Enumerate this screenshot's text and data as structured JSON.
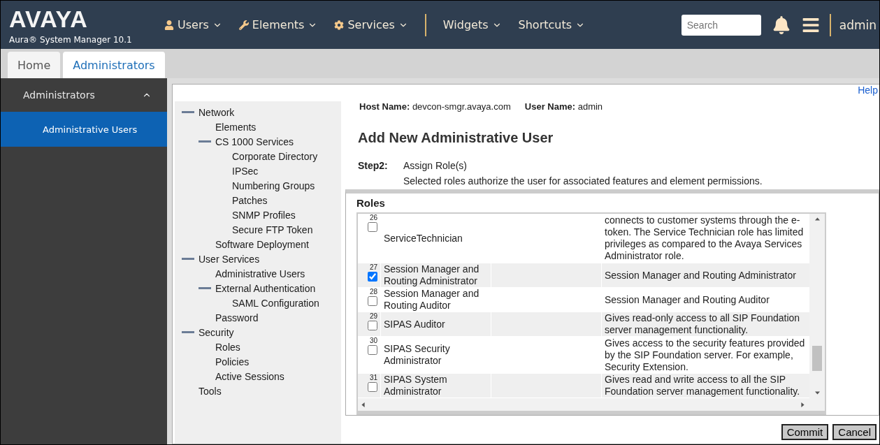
{
  "header": {
    "logo": "AVAYA",
    "product": "Aura® System Manager 10.1",
    "menus": [
      {
        "label": "Users"
      },
      {
        "label": "Elements"
      },
      {
        "label": "Services"
      }
    ],
    "menus2": [
      {
        "label": "Widgets"
      },
      {
        "label": "Shortcuts"
      }
    ],
    "search": {
      "placeholder": "Search"
    },
    "user": "admin"
  },
  "tabs": [
    {
      "label": "Home",
      "selected": false
    },
    {
      "label": "Administrators",
      "selected": true
    }
  ],
  "sidebar": {
    "section": {
      "label": "Administrators",
      "expanded": true
    },
    "items": [
      {
        "label": "Administrative Users",
        "selected": true
      }
    ]
  },
  "help": "Help",
  "tree": [
    {
      "label": "Network",
      "expanded": true,
      "children": [
        {
          "label": "Elements"
        },
        {
          "label": "CS 1000 Services",
          "expanded": true,
          "children": [
            {
              "label": "Corporate Directory"
            },
            {
              "label": "IPSec"
            },
            {
              "label": "Numbering Groups"
            },
            {
              "label": "Patches"
            },
            {
              "label": "SNMP Profiles"
            },
            {
              "label": "Secure FTP Token"
            }
          ]
        },
        {
          "label": "Software Deployment"
        }
      ]
    },
    {
      "label": "User Services",
      "expanded": true,
      "children": [
        {
          "label": "Administrative Users"
        },
        {
          "label": "External Authentication",
          "expanded": true,
          "children": [
            {
              "label": "SAML Configuration"
            }
          ]
        },
        {
          "label": "Password"
        }
      ]
    },
    {
      "label": "Security",
      "expanded": true,
      "children": [
        {
          "label": "Roles"
        },
        {
          "label": "Policies"
        },
        {
          "label": "Active Sessions"
        }
      ]
    },
    {
      "label": "Tools"
    }
  ],
  "host": {
    "host_label": "Host Name:",
    "host_value": "devcon-smgr.avaya.com",
    "user_label": "User Name:",
    "user_value": "admin"
  },
  "title": "Add New Administrative User",
  "step": {
    "label": "Step2:",
    "title": "Assign Role(s)",
    "description": "Selected roles authorize the user for associated features and element permissions."
  },
  "roles": {
    "heading": "Roles",
    "rows": [
      {
        "number": "26",
        "name": "ServiceTechnician",
        "checked": false,
        "description": "connects to customer systems through the e-token. The Service Technician role has limited privileges as compared to the Avaya Services Administrator role."
      },
      {
        "number": "27",
        "name": "Session Manager and Routing Administrator",
        "checked": true,
        "description": "Session Manager and Routing Administrator"
      },
      {
        "number": "28",
        "name": "Session Manager and Routing Auditor",
        "checked": false,
        "description": "Session Manager and Routing Auditor"
      },
      {
        "number": "29",
        "name": "SIPAS Auditor",
        "checked": false,
        "description": "Gives read-only access to all SIP Foundation server management functionality."
      },
      {
        "number": "30",
        "name": "SIPAS Security Administrator",
        "checked": false,
        "description": "Gives access to the security features provided by the SIP Foundation server. For example, Security Extension."
      },
      {
        "number": "31",
        "name": "SIPAS System Administrator",
        "checked": false,
        "description": "Gives read and write access to all the SIP Foundation server management functionality."
      }
    ]
  },
  "buttons": [
    {
      "label": "Commit"
    },
    {
      "label": "Cancel"
    }
  ]
}
